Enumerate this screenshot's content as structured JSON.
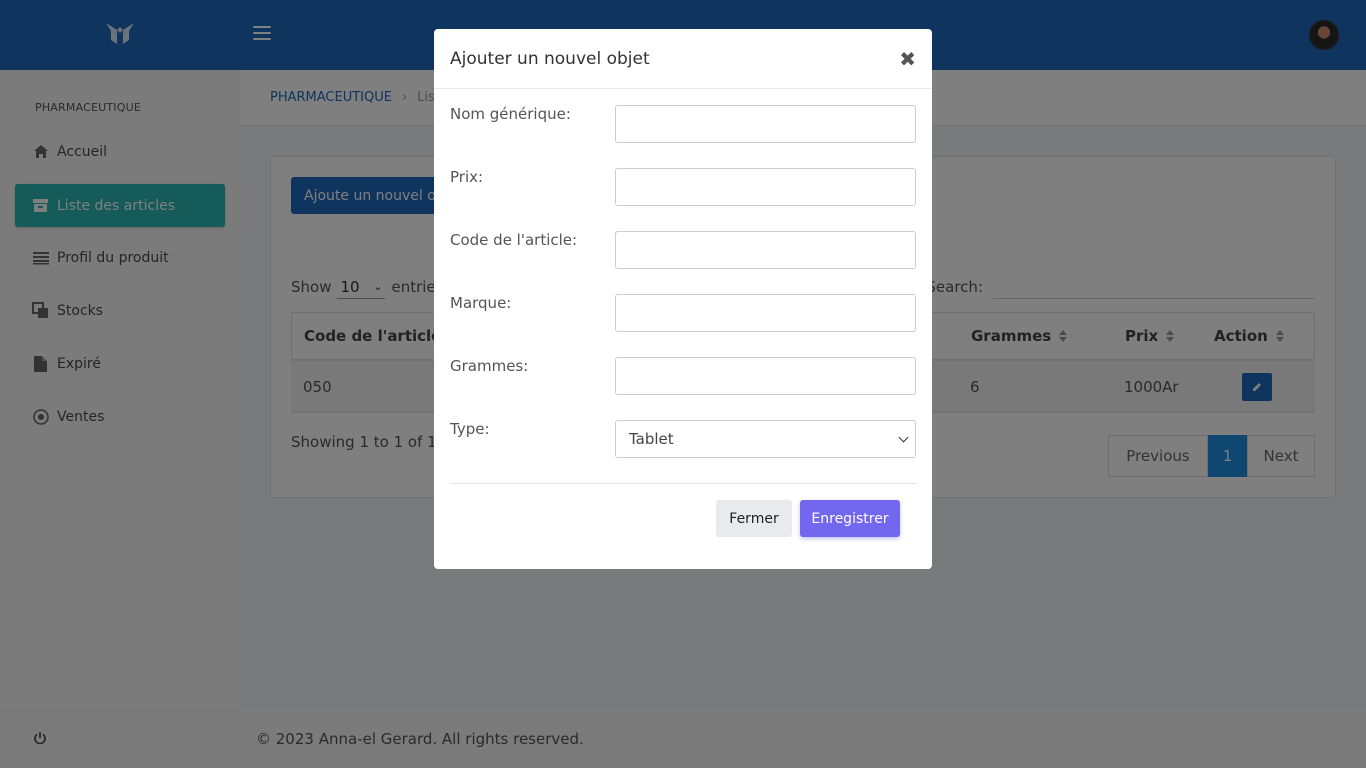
{
  "sidebar": {
    "section_title": "PHARMACEUTIQUE",
    "items": [
      {
        "label": "Accueil",
        "icon": "home-icon"
      },
      {
        "label": "Liste des articles",
        "icon": "archive-icon"
      },
      {
        "label": "Profil du produit",
        "icon": "list-icon"
      },
      {
        "label": "Stocks",
        "icon": "copy-icon"
      },
      {
        "label": "Expiré",
        "icon": "file-icon"
      },
      {
        "label": "Ventes",
        "icon": "target-icon"
      }
    ],
    "active_item": "Liste des articles"
  },
  "breadcrumb": {
    "root": "PHARMACEUTIQUE",
    "current": "Lis"
  },
  "main": {
    "add_button": "Ajoute un nouvel o",
    "show_label": "Show",
    "show_value": "10",
    "entries_label": "entrie",
    "search_label": "Search:",
    "columns": [
      "Code de l'article",
      "Grammes",
      "Prix",
      "Action"
    ],
    "rows": [
      {
        "code": "050",
        "grammes": "6",
        "prix": "1000Ar"
      }
    ],
    "showing_text": "Showing 1 to 1 of 1 e",
    "pagination": {
      "previous": "Previous",
      "current": "1",
      "next": "Next"
    }
  },
  "footer": {
    "text": "© 2023 Anna-el Gerard. All rights reserved."
  },
  "modal": {
    "title": "Ajouter un nouvel objet",
    "close_symbol": "✖",
    "fields": [
      {
        "label": "Nom générique:",
        "value": ""
      },
      {
        "label": "Prix:",
        "value": ""
      },
      {
        "label": "Code de l'article:",
        "value": ""
      },
      {
        "label": "Marque:",
        "value": ""
      },
      {
        "label": "Grammes:",
        "value": ""
      }
    ],
    "type_label": "Type:",
    "type_value": "Tablet",
    "cancel_button": "Fermer",
    "save_button": "Enregistrer"
  },
  "colors": {
    "header": "#1f68bd",
    "active_nav": "#2bb7b5",
    "save_button": "#7367f0",
    "pagination_active": "#1f8fe0"
  }
}
